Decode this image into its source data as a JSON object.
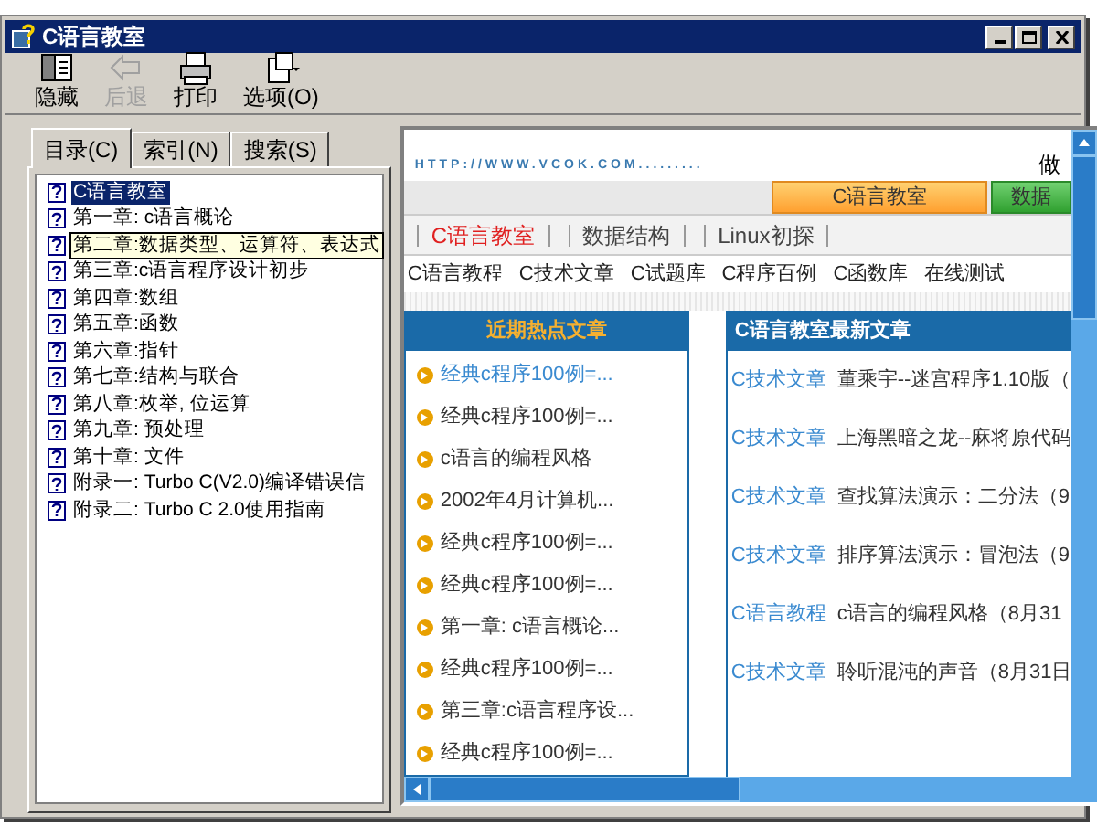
{
  "window": {
    "title": "C语言教室"
  },
  "toolbar": [
    {
      "label": "隐藏",
      "kind": "hide",
      "disabled": false
    },
    {
      "label": "后退",
      "kind": "back",
      "disabled": true
    },
    {
      "label": "打印",
      "kind": "print",
      "disabled": false
    },
    {
      "label": "选项(O)",
      "kind": "options",
      "disabled": false
    }
  ],
  "tabs": [
    {
      "label": "目录(C)",
      "selected": true
    },
    {
      "label": "索引(N)",
      "selected": false
    },
    {
      "label": "搜索(S)",
      "selected": false
    }
  ],
  "tree": [
    {
      "label": "C语言教室",
      "selected": true,
      "focused": false
    },
    {
      "label": "第一章: c语言概论",
      "selected": false,
      "focused": false
    },
    {
      "label": "第二章:数据类型、运算符、表达式",
      "selected": false,
      "focused": true
    },
    {
      "label": "第三章:c语言程序设计初步",
      "selected": false,
      "focused": false
    },
    {
      "label": "第四章:数组",
      "selected": false,
      "focused": false
    },
    {
      "label": "第五章:函数",
      "selected": false,
      "focused": false
    },
    {
      "label": "第六章:指针",
      "selected": false,
      "focused": false
    },
    {
      "label": "第七章:结构与联合",
      "selected": false,
      "focused": false
    },
    {
      "label": "第八章:枚举, 位运算",
      "selected": false,
      "focused": false
    },
    {
      "label": "第九章: 预处理",
      "selected": false,
      "focused": false
    },
    {
      "label": "第十章: 文件",
      "selected": false,
      "focused": false
    },
    {
      "label": "附录一: Turbo C(V2.0)编译错误信",
      "selected": false,
      "focused": false
    },
    {
      "label": "附录二: Turbo C 2.0使用指南",
      "selected": false,
      "focused": false
    }
  ],
  "web": {
    "url_banner": "HTTP://WWW.VCOK.COM.........",
    "banner_right": "做",
    "site_tabs": [
      {
        "label": "C语言教室",
        "selected": true
      },
      {
        "label": "数据",
        "selected": false
      }
    ],
    "nav": [
      {
        "label": "C语言教室",
        "selected": true
      },
      {
        "label": "数据结构",
        "selected": false
      },
      {
        "label": "Linux初探",
        "selected": false
      }
    ],
    "sub_links": [
      "C语言教程",
      "C技术文章",
      "C试题库",
      "C程序百例",
      "C函数库",
      "在线测试"
    ],
    "hot": {
      "title": "近期热点文章",
      "items": [
        {
          "text": "经典c程序100例=...",
          "visited": true
        },
        {
          "text": "经典c程序100例=...",
          "visited": false
        },
        {
          "text": "c语言的编程风格",
          "visited": false
        },
        {
          "text": "2002年4月计算机...",
          "visited": false
        },
        {
          "text": "经典c程序100例=...",
          "visited": false
        },
        {
          "text": "经典c程序100例=...",
          "visited": false
        },
        {
          "text": "第一章: c语言概论...",
          "visited": false
        },
        {
          "text": "经典c程序100例=...",
          "visited": false
        },
        {
          "text": "第三章:c语言程序设...",
          "visited": false
        },
        {
          "text": "经典c程序100例=...",
          "visited": false
        }
      ]
    },
    "latest": {
      "title": "C语言教室最新文章",
      "items": [
        {
          "category": "C技术文章",
          "title": "董乘宇--迷宫程序1.10版（"
        },
        {
          "category": "C技术文章",
          "title": "上海黑暗之龙--麻将原代码"
        },
        {
          "category": "C技术文章",
          "title": "查找算法演示：二分法（9"
        },
        {
          "category": "C技术文章",
          "title": "排序算法演示：冒泡法（9"
        },
        {
          "category": "C语言教程",
          "title": "c语言的编程风格（8月31"
        },
        {
          "category": "C技术文章",
          "title": "聆听混沌的声音（8月31日"
        }
      ]
    }
  }
}
